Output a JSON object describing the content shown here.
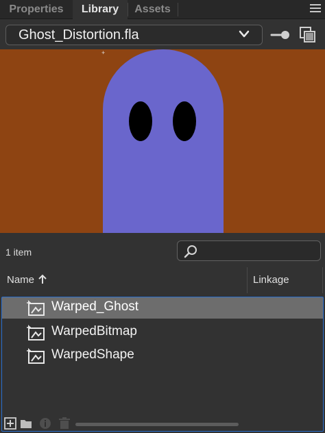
{
  "tabs": {
    "properties": "Properties",
    "library": "Library",
    "assets": "Assets"
  },
  "document": {
    "selected": "Ghost_Distortion.fla"
  },
  "preview": {
    "background_color": "#8e4412",
    "ghost_color": "#6a66cc",
    "eye_color": "#000000"
  },
  "library": {
    "count_text": "1 item",
    "search_placeholder": "",
    "columns": {
      "name": "Name",
      "linkage": "Linkage"
    },
    "items": [
      {
        "name": "Warped_Ghost",
        "icon": "movie-clip-icon",
        "selected": true
      },
      {
        "name": "WarpedBitmap",
        "icon": "movie-clip-icon",
        "selected": false
      },
      {
        "name": "WarpedShape",
        "icon": "movie-clip-icon",
        "selected": false
      }
    ]
  },
  "footer": {
    "icons": [
      "new-symbol-icon",
      "new-folder-icon",
      "properties-info-icon",
      "delete-trash-icon"
    ]
  },
  "colors": {
    "accent": "#2a6fd0",
    "panel": "#323232",
    "selected_row": "#6d6d6d"
  }
}
